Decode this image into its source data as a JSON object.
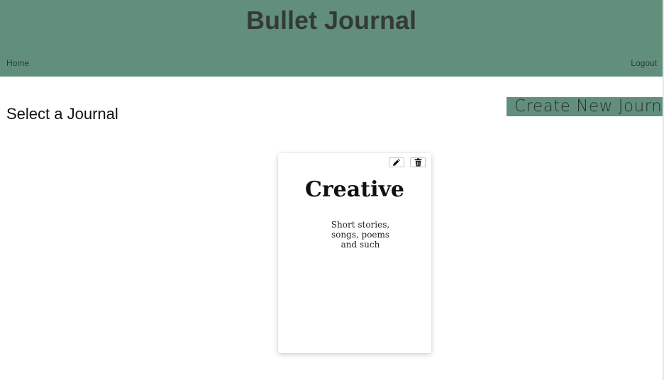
{
  "header": {
    "title": "Bullet Journal",
    "nav": {
      "home_label": "Home",
      "logout_label": "Logout"
    },
    "background_color": "#628f7c"
  },
  "main": {
    "heading": "Select a Journal",
    "create_button_label": "Create New Journal"
  },
  "journals": [
    {
      "title": "Creative",
      "description": "Short stories, songs, poems and such",
      "actions": {
        "edit_icon": "pencil-icon",
        "delete_icon": "trash-icon"
      }
    }
  ]
}
